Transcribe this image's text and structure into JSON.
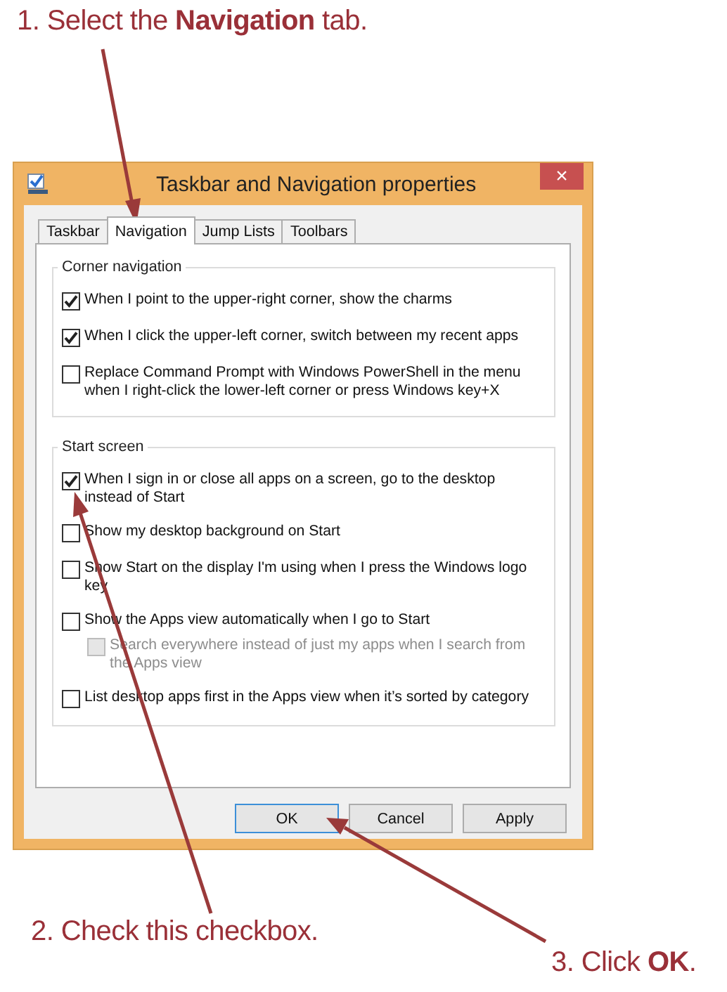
{
  "callouts": [
    {
      "text": "1. Select the **Navigation** tab."
    },
    {
      "text": "2. Check this checkbox."
    },
    {
      "text": "3. Click **OK**."
    }
  ],
  "window": {
    "title": "Taskbar and Navigation properties",
    "close": "×"
  },
  "tabs": [
    {
      "label": "Taskbar",
      "selected": false
    },
    {
      "label": "Navigation",
      "selected": true
    },
    {
      "label": "Jump Lists",
      "selected": false
    },
    {
      "label": "Toolbars",
      "selected": false
    }
  ],
  "groups": [
    {
      "title": "Corner navigation",
      "options": [
        {
          "label": "When I point to the upper-right corner, show the charms",
          "checked": true,
          "disabled": false
        },
        {
          "label": "When I click the upper-left corner, switch between my recent apps",
          "checked": true,
          "disabled": false
        },
        {
          "label": "Replace Command Prompt with Windows PowerShell in the menu when I right-click the lower-left corner or press Windows key+X",
          "checked": false,
          "disabled": false
        }
      ]
    },
    {
      "title": "Start screen",
      "options": [
        {
          "label": "When I sign in or close all apps on a screen, go to the desktop instead of Start",
          "checked": true,
          "disabled": false
        },
        {
          "label": "Show my desktop background on Start",
          "checked": false,
          "disabled": false
        },
        {
          "label": "Show Start on the display I'm using when I press the Windows logo key",
          "checked": false,
          "disabled": false
        },
        {
          "label": "Show the Apps view automatically when I go to Start",
          "checked": false,
          "disabled": false,
          "children": [
            {
              "label": "Search everywhere instead of just my apps when I search from the Apps view",
              "checked": false,
              "disabled": true
            }
          ]
        },
        {
          "label": "List desktop apps first in the Apps view when it’s sorted by category",
          "checked": false,
          "disabled": false
        }
      ]
    }
  ],
  "buttons": [
    {
      "label": "OK",
      "focused": true
    },
    {
      "label": "Cancel",
      "focused": false
    },
    {
      "label": "Apply",
      "focused": false
    }
  ]
}
